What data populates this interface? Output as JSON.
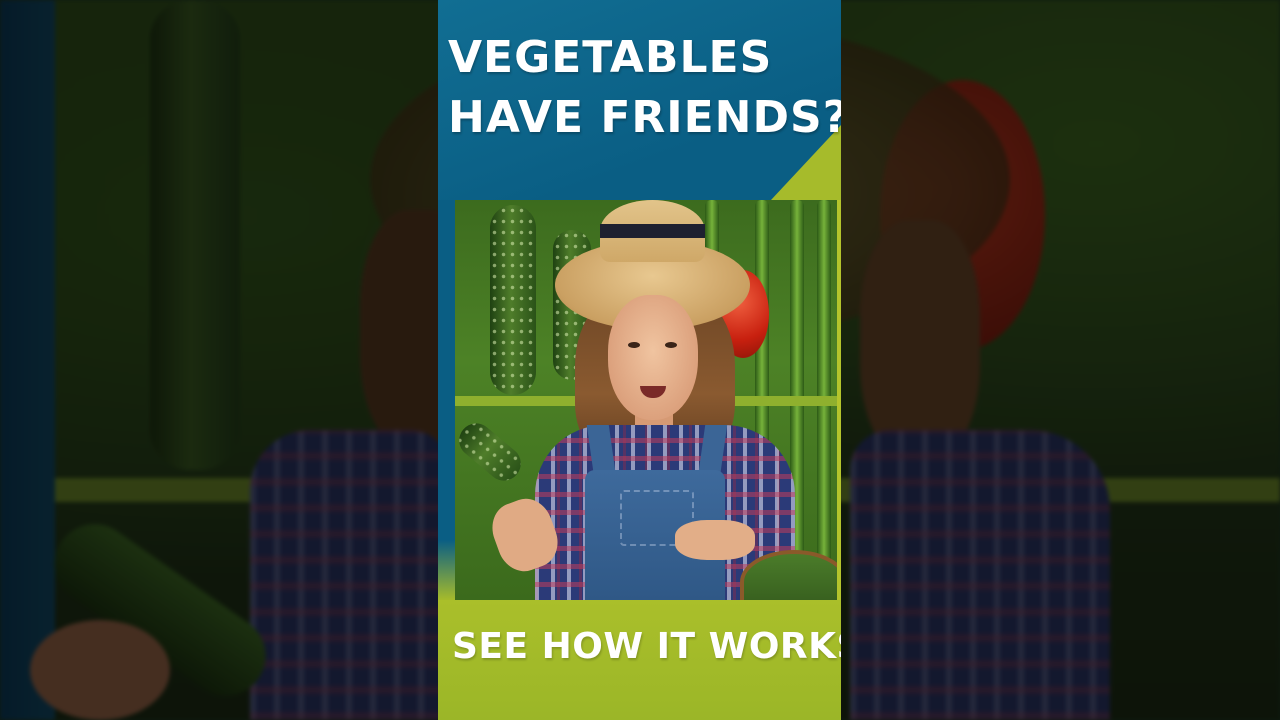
{
  "video": {
    "headline_line1": "VEGETABLES",
    "headline_line2": "HAVE FRIENDS?",
    "call_to_action": "SEE HOW IT WORKS."
  },
  "colors": {
    "header_blue": "#0a5e84",
    "accent_green": "#a6bb2b",
    "text": "#ffffff"
  }
}
